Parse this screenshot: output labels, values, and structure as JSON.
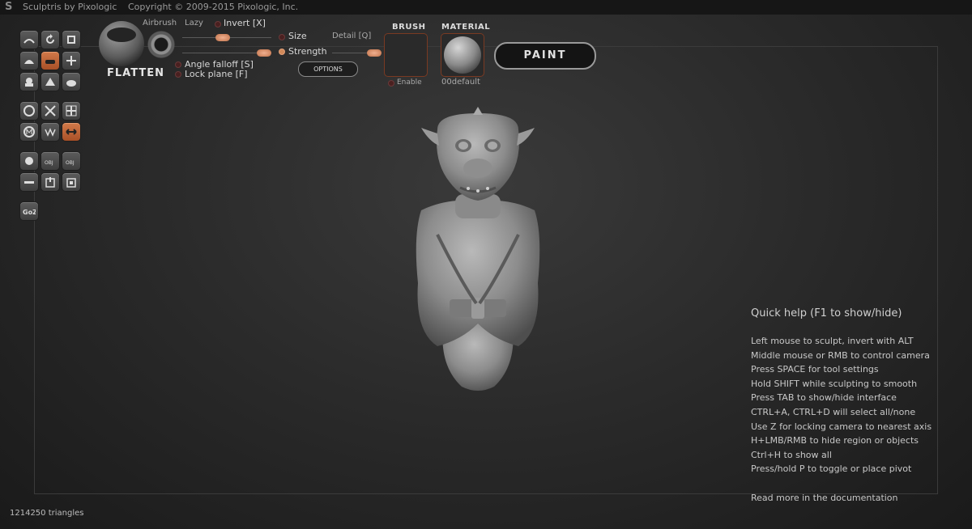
{
  "window": {
    "app_title": "Sculptris by Pixologic",
    "copyright": "Copyright © 2009-2015 Pixologic, Inc."
  },
  "tools": {
    "icons": [
      "crease-icon",
      "rotate-icon",
      "scale-icon",
      "draw-icon",
      "flatten-icon",
      "grab-icon",
      "inflate-icon",
      "pinch-icon",
      "smooth-icon",
      "reduce-icon",
      "mask-icon",
      "grid-icon",
      "symmetry-icon",
      "wireframe-icon",
      "mirror-icon",
      "sphere-icon",
      "import-obj-icon",
      "export-obj-icon",
      "plane-icon",
      "save-icon",
      "open-icon",
      "goz-icon"
    ],
    "goz_label": "GoZ",
    "obj_label": "OBJ"
  },
  "brush": {
    "name": "FLATTEN",
    "airbrush": "Airbrush",
    "lazy": "Lazy",
    "invert": "Invert [X]",
    "size": "Size",
    "detail": "Detail [Q]",
    "strength": "Strength",
    "angle_falloff": "Angle falloff [S]",
    "lock_plane": "Lock plane [F]",
    "options": "OPTIONS",
    "size_value": 0.5,
    "strength_value": 0.85,
    "detail_value": 0.8
  },
  "brush_texture": {
    "title": "BRUSH",
    "enable": "Enable"
  },
  "material": {
    "title": "MATERIAL",
    "name": "00default"
  },
  "paint_button": "PAINT",
  "quick_help": {
    "title": "Quick help (F1 to show/hide)",
    "lines": [
      "Left mouse to sculpt, invert with ALT",
      "Middle mouse or RMB to control camera",
      "Press SPACE for tool settings",
      "Hold SHIFT while sculpting to smooth",
      "Press TAB to show/hide interface",
      "CTRL+A, CTRL+D will select all/none",
      "Use Z for locking camera to nearest axis",
      "H+LMB/RMB to hide region or objects",
      "Ctrl+H to show all",
      "Press/hold P to toggle or place pivot"
    ],
    "more": "Read more in the documentation"
  },
  "status": {
    "triangles": "1214250 triangles"
  }
}
